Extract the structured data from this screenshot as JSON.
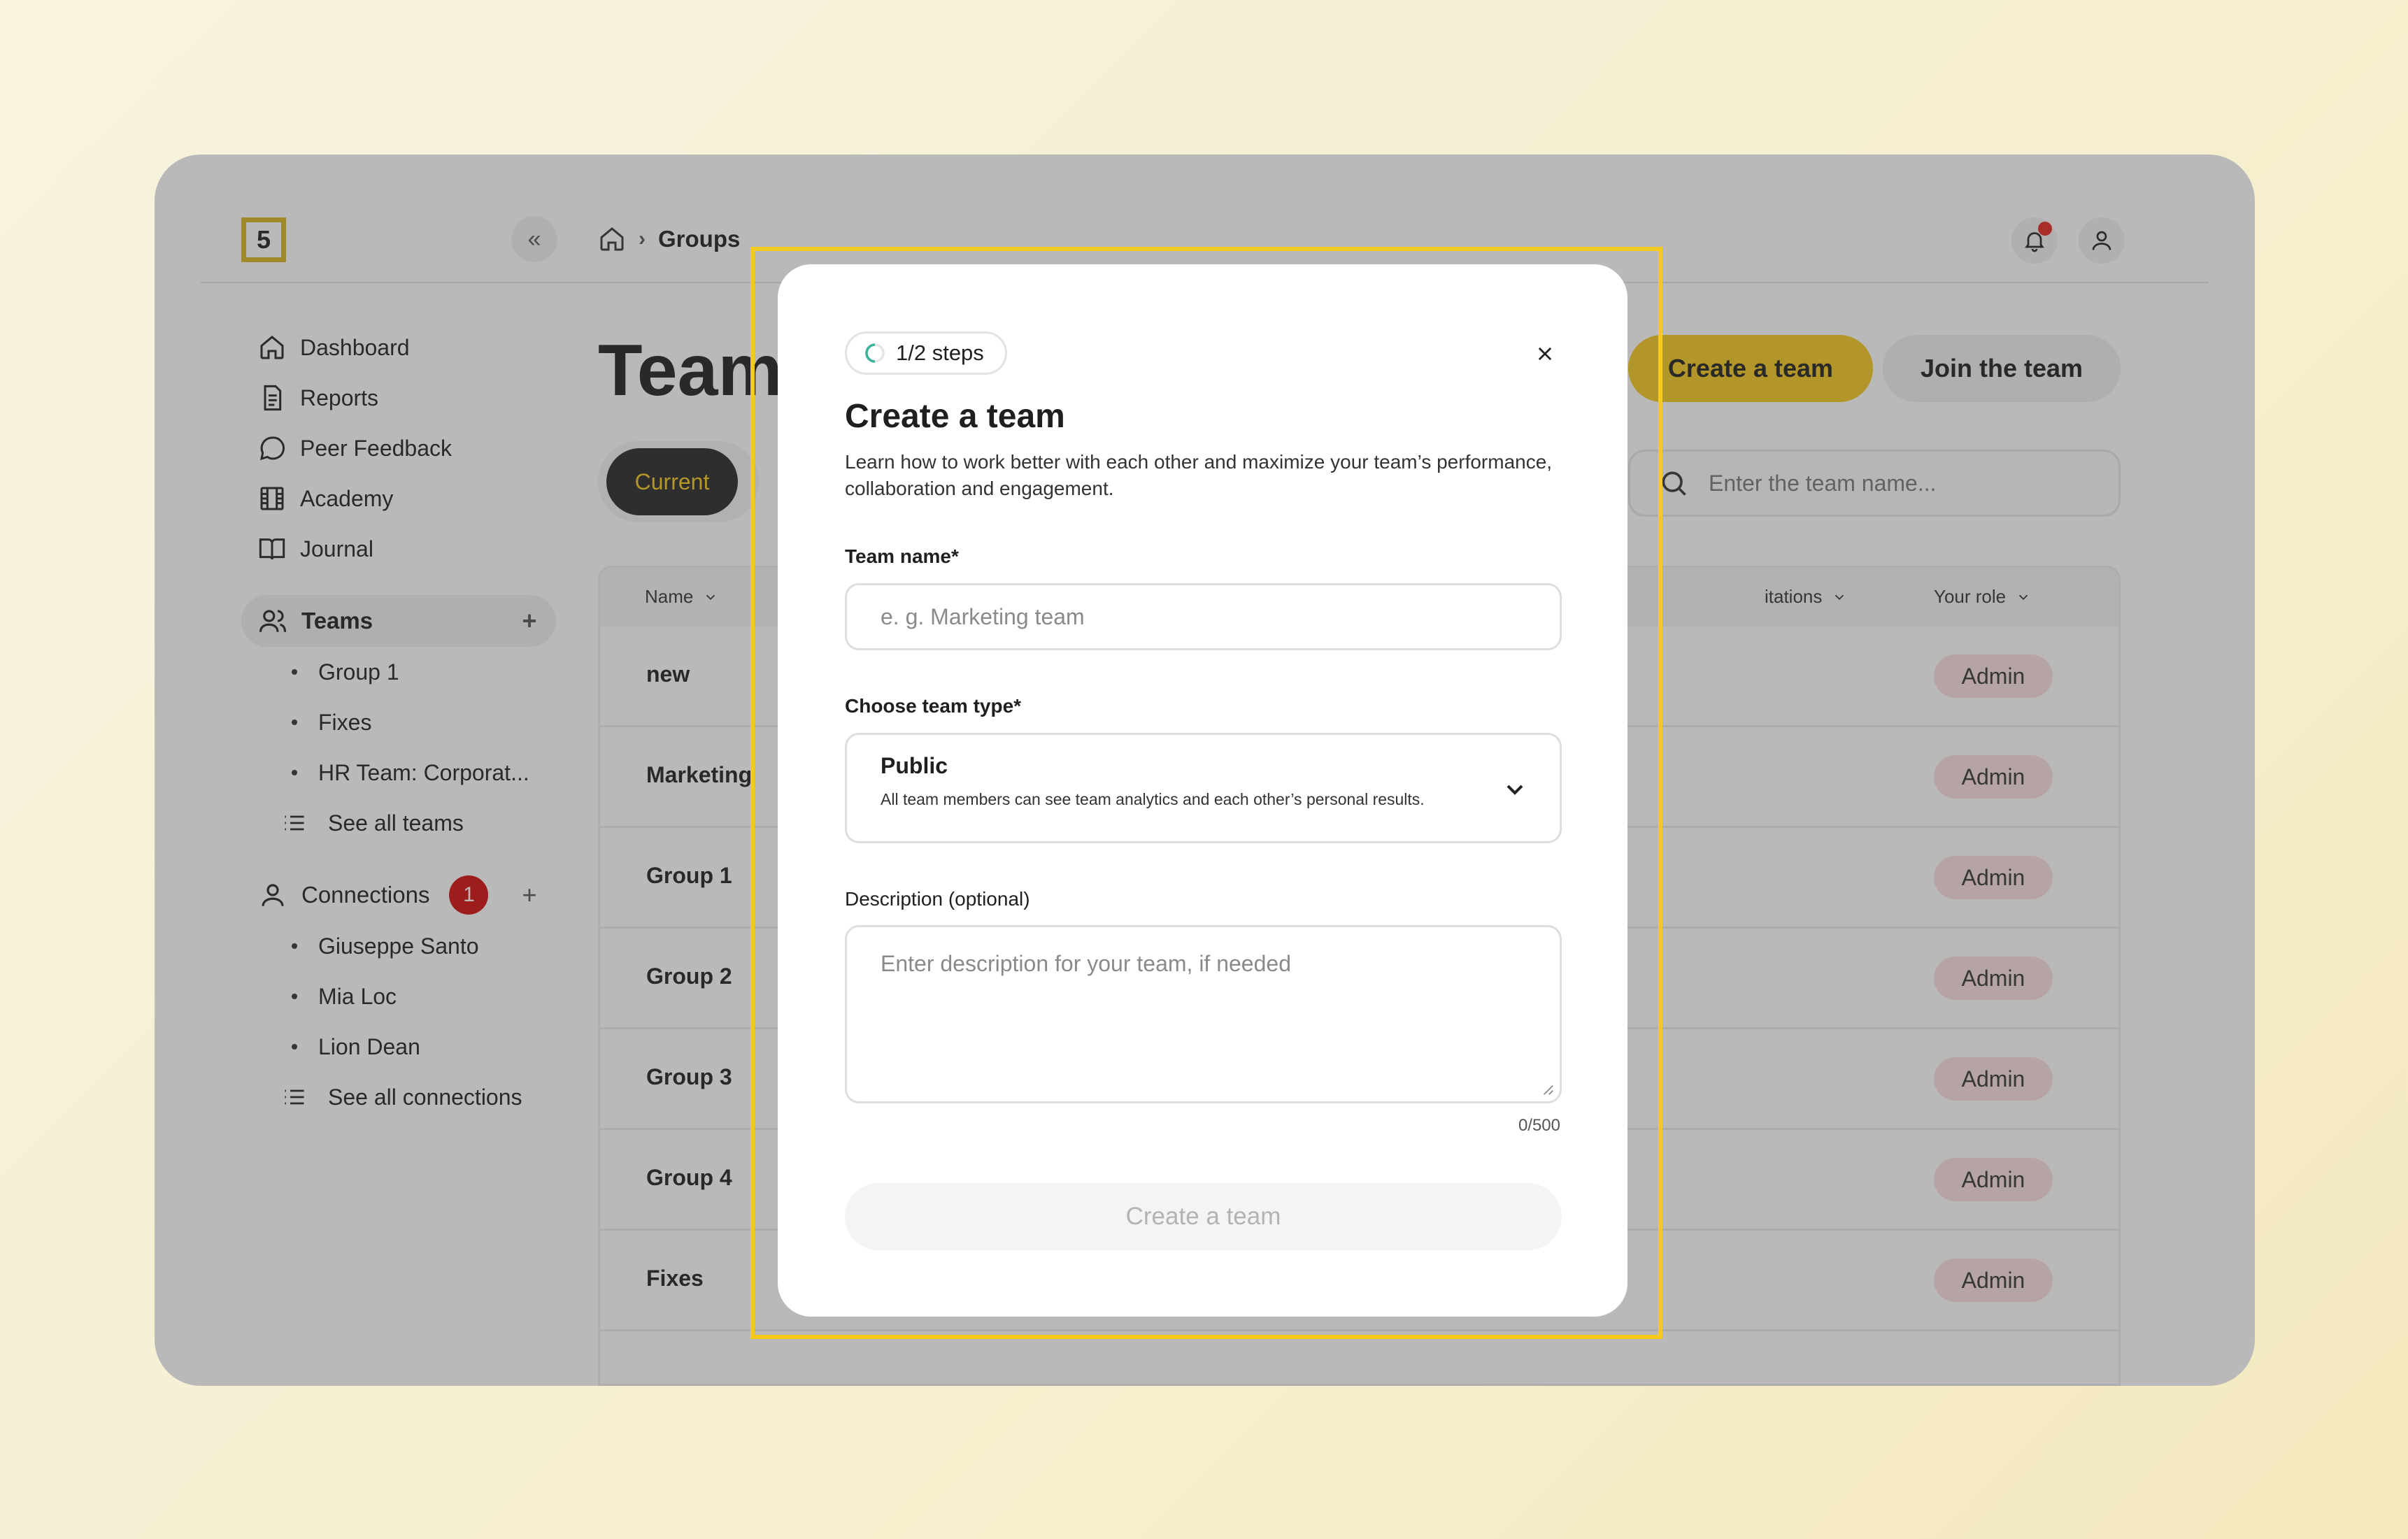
{
  "logo": {
    "text": "5"
  },
  "breadcrumb": {
    "current": "Groups"
  },
  "sidebar": {
    "nav": [
      {
        "label": "Dashboard",
        "icon": "home-icon"
      },
      {
        "label": "Reports",
        "icon": "document-icon"
      },
      {
        "label": "Peer Feedback",
        "icon": "chat-bubble-icon"
      },
      {
        "label": "Academy",
        "icon": "film-icon"
      },
      {
        "label": "Journal",
        "icon": "book-icon"
      }
    ],
    "teams": {
      "label": "Teams",
      "add": "+",
      "items": [
        "Group 1",
        "Fixes",
        "HR Team: Corporat..."
      ],
      "see_all": "See all teams"
    },
    "connections": {
      "label": "Connections",
      "count": "1",
      "add": "+",
      "items": [
        "Giuseppe Santo",
        "Mia Loc",
        "Lion Dean"
      ],
      "see_all": "See all connections"
    }
  },
  "main": {
    "title": "Team",
    "create_button": "Create a team",
    "join_button": "Join the team",
    "tab_current": "Current",
    "search_placeholder": "Enter the team name...",
    "table": {
      "col_name": "Name",
      "col_invitations": "itations",
      "col_role": "Your role",
      "rows": [
        {
          "name": "new",
          "role": "Admin"
        },
        {
          "name": "Marketing",
          "role": "Admin"
        },
        {
          "name": "Group 1",
          "role": "Admin"
        },
        {
          "name": "Group 2",
          "role": "Admin"
        },
        {
          "name": "Group 3",
          "role": "Admin"
        },
        {
          "name": "Group 4",
          "role": "Admin"
        },
        {
          "name": "Fixes",
          "role": "Admin"
        }
      ]
    }
  },
  "modal": {
    "steps": "1/2 steps",
    "title": "Create a team",
    "description": "Learn how to work better with each other and maximize your team’s performance, collaboration and engagement.",
    "team_name_label": "Team name*",
    "team_name_placeholder": "e. g. Marketing team",
    "team_type_label": "Choose team type*",
    "team_type_value": "Public",
    "team_type_hint": "All team members can see team analytics and each other’s personal results.",
    "description_label": "Description (optional)",
    "description_placeholder": "Enter description for your team, if needed",
    "char_counter": "0/500",
    "submit": "Create a team"
  },
  "colors": {
    "accent": "#f5c81e",
    "badge_red": "#d40b0b",
    "role_badge": "#fbdede",
    "delete_red": "#e03030"
  }
}
